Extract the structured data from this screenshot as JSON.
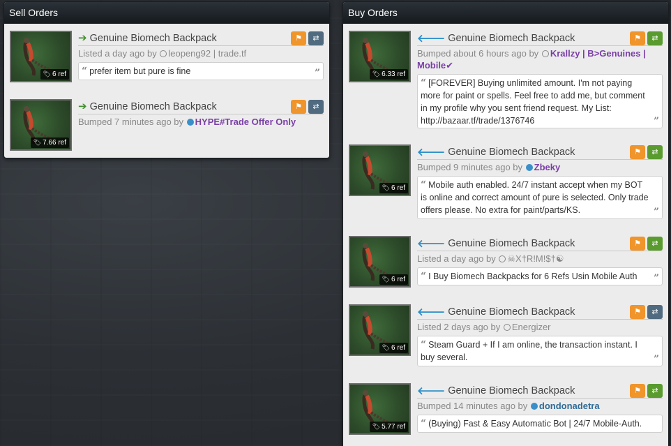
{
  "sell": {
    "title": "Sell Orders",
    "listings": [
      {
        "name": "Genuine Biomech Backpack",
        "price": "6 ref",
        "status": "Listed a day ago by",
        "user": "leopeng92 | trade.tf",
        "comment": "prefer item but pure is fine"
      },
      {
        "name": "Genuine Biomech Backpack",
        "price": "7.66 ref",
        "status": "Bumped 7 minutes ago by",
        "user": "HYPE#Trade Offer Only"
      }
    ]
  },
  "buy": {
    "title": "Buy Orders",
    "listings": [
      {
        "name": "Genuine Biomech Backpack",
        "price": "6.33 ref",
        "status": "Bumped about 6 hours ago by",
        "user": "Krallzy | B>Genuines | Mobile✔",
        "comment": "[FOREVER] Buying unlimited amount. I'm not paying more for paint or spells. Feel free to add me, but comment in my profile why you sent friend request. My List: http://bazaar.tf/trade/1376746"
      },
      {
        "name": "Genuine Biomech Backpack",
        "price": "6 ref",
        "status": "Bumped 9 minutes ago by",
        "user": "Zbeky",
        "comment": "Mobile auth enabled. 24/7 instant accept when my BOT is online and correct amount of pure is selected. Only trade offers please. No extra for paint/parts/KS."
      },
      {
        "name": "Genuine Biomech Backpack",
        "price": "6 ref",
        "status": "Listed a day ago by",
        "user": "☠X†R!M!$†☯",
        "comment": "I Buy Biomech Backpacks for 6 Refs Usin Mobile Auth"
      },
      {
        "name": "Genuine Biomech Backpack",
        "price": "6 ref",
        "status": "Listed 2 days ago by",
        "user": "Energizer",
        "comment": "Steam Guard + If I am online, the transaction instant. I buy several."
      },
      {
        "name": "Genuine Biomech Backpack",
        "price": "5.77 ref",
        "status": "Bumped 14 minutes ago by",
        "user": "dondonadetra",
        "comment": "(Buying) Fast & Easy Automatic Bot | 24/7 Mobile-Auth."
      }
    ]
  },
  "colors": {
    "flag": "#f0952b",
    "swap_gray": "#506b80",
    "swap_green": "#5a9b2f",
    "user_purple": "#7a3fa6",
    "user_blue": "#2f6b97"
  }
}
